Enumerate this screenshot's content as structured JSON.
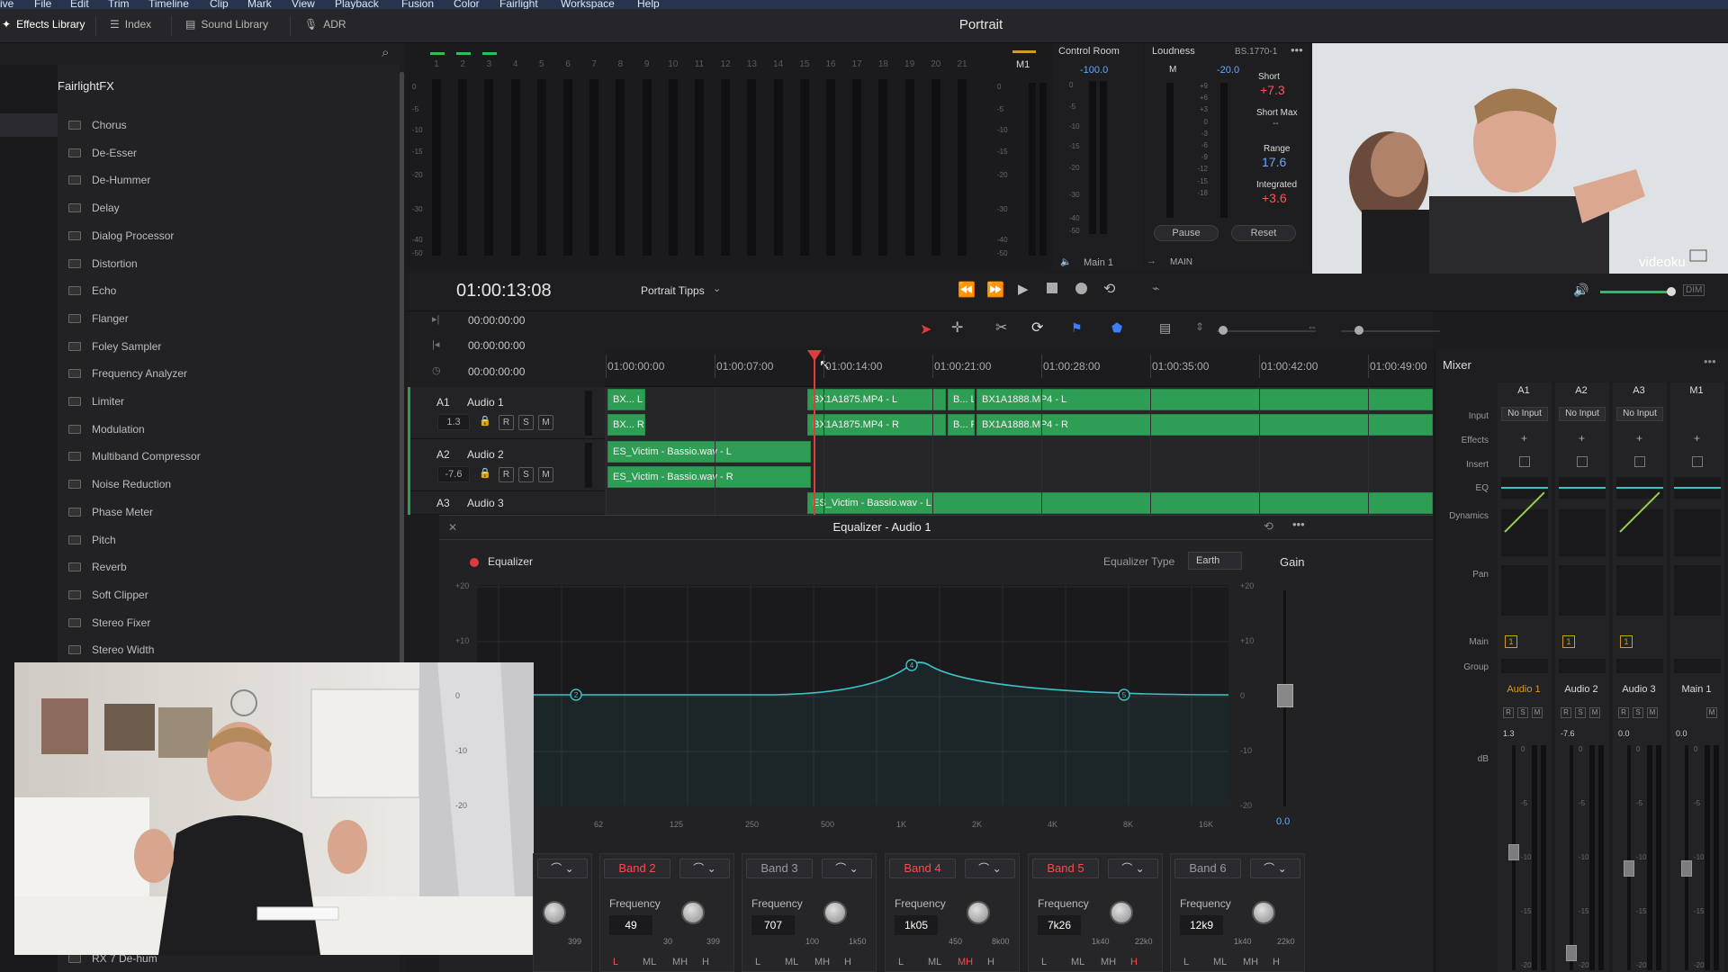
{
  "menu": [
    "ive",
    "File",
    "Edit",
    "Trim",
    "Timeline",
    "Clip",
    "Mark",
    "View",
    "Playback",
    "Fusion",
    "Color",
    "Fairlight",
    "Workspace",
    "Help"
  ],
  "toolbar": {
    "effects_library": "Effects Library",
    "index": "Index",
    "sound_library": "Sound Library",
    "adr": "ADR",
    "project_title": "Portrait"
  },
  "library": {
    "title": "FairlightFX",
    "items": [
      "Chorus",
      "De-Esser",
      "De-Hummer",
      "Delay",
      "Dialog Processor",
      "Distortion",
      "Echo",
      "Flanger",
      "Foley Sampler",
      "Frequency Analyzer",
      "Limiter",
      "Modulation",
      "Multiband Compressor",
      "Noise Reduction",
      "Phase Meter",
      "Pitch",
      "Reverb",
      "Soft Clipper",
      "Stereo Fixer",
      "Stereo Width"
    ],
    "partial_item": "RX 7 De-hum"
  },
  "meters": {
    "channels": [
      "1",
      "2",
      "3",
      "4",
      "5",
      "6",
      "7",
      "8",
      "9",
      "10",
      "11",
      "12",
      "13",
      "14",
      "15",
      "16",
      "17",
      "18",
      "19",
      "20",
      "21"
    ],
    "scale": [
      "0",
      "-5",
      "-10",
      "-15",
      "-20",
      "-30",
      "-40",
      "-50"
    ],
    "main_label": "M1"
  },
  "control_room": {
    "title": "Control Room",
    "value": "-100.0",
    "scale": [
      "0",
      "-5",
      "-10",
      "-15",
      "-20",
      "-30",
      "-40",
      "-50"
    ],
    "output": "Main 1",
    "route": "MAIN"
  },
  "loudness": {
    "title": "Loudness",
    "standard": "BS.1770-1",
    "m_label": "M",
    "target": "-20.0",
    "scale": [
      "+9",
      "+6",
      "+3",
      "0",
      "-3",
      "-6",
      "-9",
      "-12",
      "-15",
      "-18"
    ],
    "short_label": "Short",
    "short_value": "+7.3",
    "short_max_label": "Short Max",
    "short_max_value": "--",
    "range_label": "Range",
    "range_value": "17.6",
    "integrated_label": "Integrated",
    "integrated_value": "+3.6",
    "pause": "Pause",
    "reset": "Reset"
  },
  "viewer": {
    "watermark": "videoku"
  },
  "timeline": {
    "timecode": "01:00:13:08",
    "name": "Portrait Tipps",
    "tc_rows": [
      "00:00:00:00",
      "00:00:00:00",
      "00:00:00:00"
    ],
    "ruler": [
      "01:00:00:00",
      "01:00:07:00",
      "01:00:14:00",
      "01:00:21:00",
      "01:00:28:00",
      "01:00:35:00",
      "01:00:42:00",
      "01:00:49:00"
    ],
    "tracks": [
      {
        "id": "A1",
        "name": "Audio 1",
        "volume": "1.3"
      },
      {
        "id": "A2",
        "name": "Audio 2",
        "volume": "-7.6"
      },
      {
        "id": "A3",
        "name": "Audio 3"
      }
    ],
    "buttons": {
      "r": "R",
      "s": "S",
      "m": "M"
    },
    "clips": {
      "a1_l1": "BX... L",
      "a1_r1": "BX... R",
      "a1_l2": "BX1A1875.MP4 - L",
      "a1_r2": "BX1A1875.MP4 - R",
      "a1_l3": "B... L",
      "a1_r3": "B... R",
      "a1_l4": "BX1A1888.MP4 - L",
      "a1_r4": "BX1A1888.MP4 - R",
      "a2_l": "ES_Victim - Bassio.wav - L",
      "a2_r": "ES_Victim - Bassio.wav - R",
      "a3_l": "ES_Victim - Bassio.wav - L"
    }
  },
  "mixer": {
    "title": "Mixer",
    "row_labels": [
      "Input",
      "Effects",
      "Insert",
      "EQ",
      "Dynamics",
      "Pan",
      "Main",
      "Group",
      "dB"
    ],
    "columns": [
      {
        "id": "A1",
        "input": "No Input",
        "main": "1",
        "name": "Audio 1",
        "value": "1.3",
        "active": true
      },
      {
        "id": "A2",
        "input": "No Input",
        "main": "1",
        "name": "Audio 2",
        "value": "-7.6",
        "active": false
      },
      {
        "id": "A3",
        "input": "No Input",
        "main": "1",
        "name": "Audio 3",
        "value": "0.0",
        "active": false
      },
      {
        "id": "M1",
        "input": "",
        "main": "",
        "name": "Main 1",
        "value": "0.0",
        "active": false
      }
    ],
    "fader_scale": [
      "0",
      "-5",
      "-10",
      "-15",
      "-20"
    ],
    "plus": "+"
  },
  "equalizer": {
    "window_title": "Equalizer - Audio 1",
    "label": "Equalizer",
    "type_label": "Equalizer Type",
    "type_value": "Earth",
    "gain_label": "Gain",
    "gain_value": "0.0",
    "db_scale": [
      "+20",
      "+10",
      "0",
      "-10",
      "-20"
    ],
    "freq_scale": [
      "62",
      "125",
      "250",
      "500",
      "1K",
      "2K",
      "4K",
      "8K",
      "16K"
    ],
    "node_labels": [
      "2",
      "4",
      "5"
    ],
    "freq_label": "Frequency",
    "filters": [
      "L",
      "ML",
      "MH",
      "H"
    ],
    "bands": [
      {
        "name": "",
        "value": "",
        "min": "0",
        "max": "399",
        "on": false
      },
      {
        "name": "Band 2",
        "value": "49",
        "min": "30",
        "max": "399",
        "on": true
      },
      {
        "name": "Band 3",
        "value": "707",
        "min": "100",
        "max": "1k50",
        "on": false
      },
      {
        "name": "Band 4",
        "value": "1k05",
        "min": "450",
        "max": "8k00",
        "on": true
      },
      {
        "name": "Band 5",
        "value": "7k26",
        "min": "1k40",
        "max": "22k0",
        "on": true
      },
      {
        "name": "Band 6",
        "value": "12k9",
        "min": "1k40",
        "max": "22k0",
        "on": false
      }
    ]
  },
  "colors": {
    "clip": "#2f9e55",
    "accent_red": "#ff4a4a",
    "eq_curve": "#3fc1c6",
    "main_orange": "#d39a2b"
  }
}
